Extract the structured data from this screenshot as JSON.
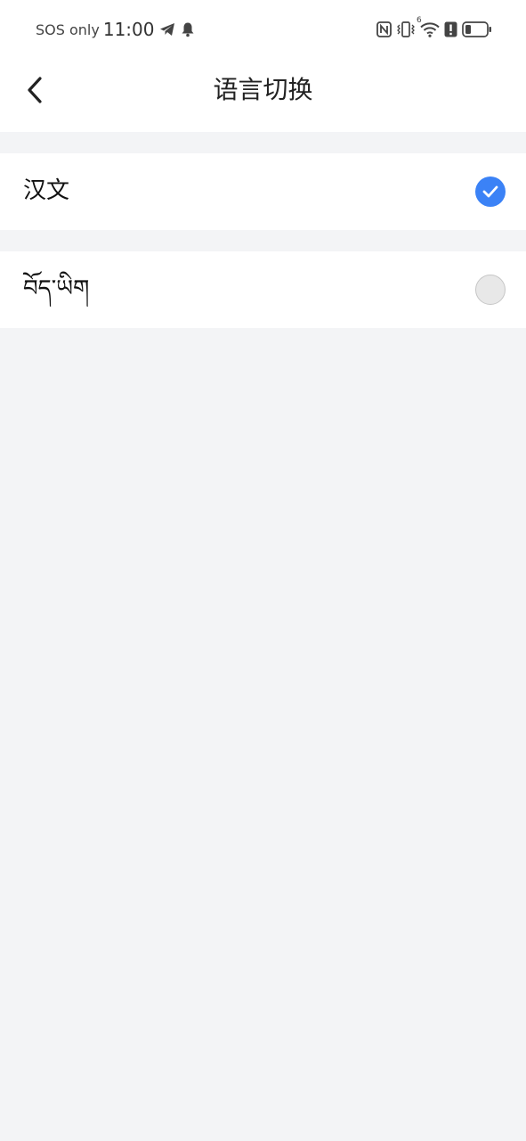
{
  "status_bar": {
    "carrier": "SOS only",
    "time": "11:00",
    "icons_left": [
      "telegram-icon",
      "bell-icon"
    ],
    "icons_right": [
      "nfc-icon",
      "vibrate-icon",
      "wifi-icon",
      "alert-icon",
      "battery-icon"
    ],
    "wifi_badge": "6"
  },
  "header": {
    "back_icon": "chevron-left-icon",
    "title": "语言切换"
  },
  "options": [
    {
      "label": "汉文",
      "selected": true
    },
    {
      "label": "བོད་ཡིག",
      "selected": false
    }
  ],
  "colors": {
    "accent": "#3b82f6",
    "background": "#f3f4f6",
    "surface": "#ffffff"
  }
}
